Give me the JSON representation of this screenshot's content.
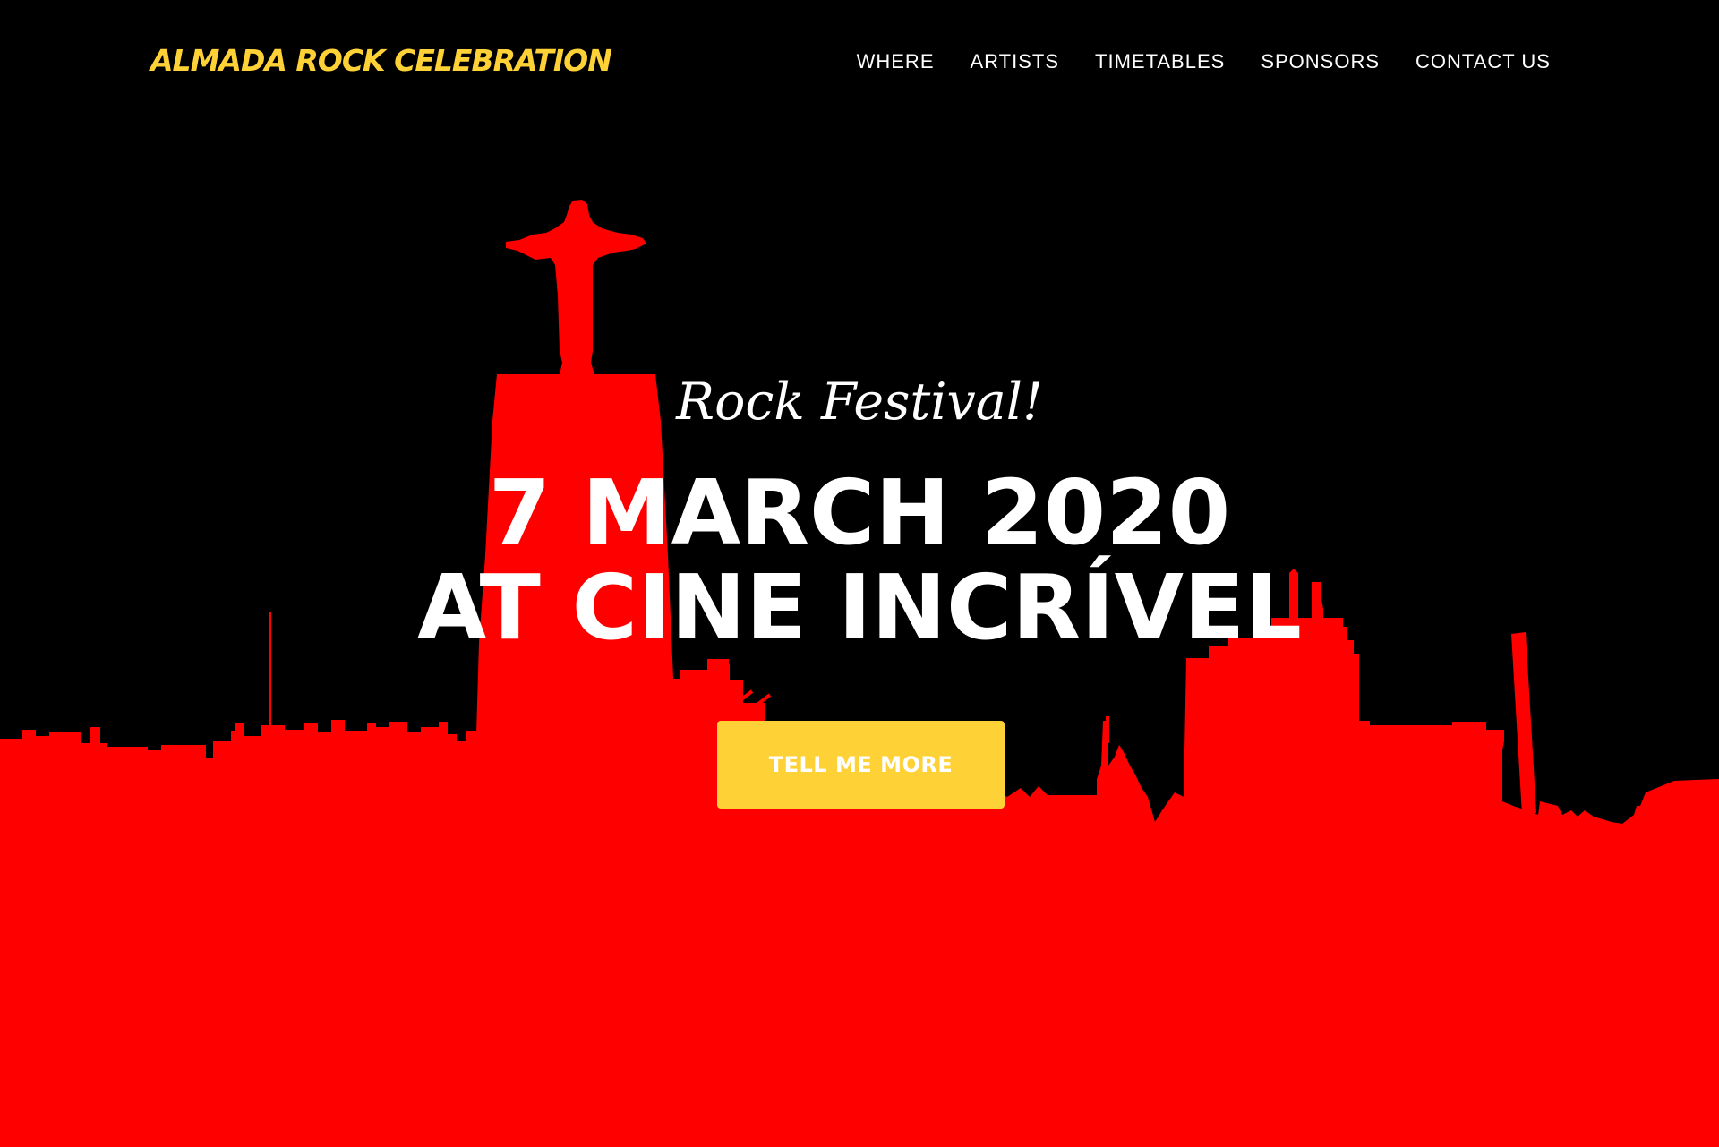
{
  "header": {
    "brand": "ALMADA ROCK CELEBRATION",
    "nav_items": [
      {
        "label": "WHERE"
      },
      {
        "label": "ARTISTS"
      },
      {
        "label": "TIMETABLES"
      },
      {
        "label": "SPONSORS"
      },
      {
        "label": "CONTACT US"
      }
    ]
  },
  "hero": {
    "subheading": "Rock Festival!",
    "heading_line1": "7 MARCH 2020",
    "heading_line2": "AT CINE INCRÍVEL",
    "cta_label": "TELL ME MORE"
  },
  "colors": {
    "background": "#000000",
    "skyline": "#ff0000",
    "accent": "#fed136",
    "text": "#ffffff"
  }
}
